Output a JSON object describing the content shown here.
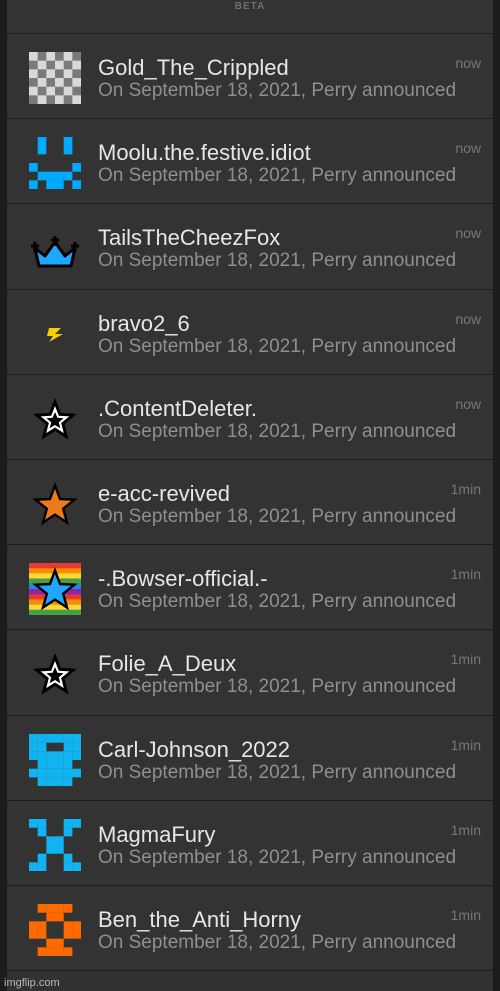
{
  "header": {
    "label": "BETA"
  },
  "items": [
    {
      "name": "Gold_The_Crippled",
      "subtitle": "On September 18, 2021, Perry announced",
      "time": "now",
      "icon": "checkerboard-icon",
      "color": "#d9d9d9"
    },
    {
      "name": "Moolu.the.festive.idiot",
      "subtitle": "On September 18, 2021, Perry announced",
      "time": "now",
      "icon": "pixel-face-icon",
      "color": "#00aaff"
    },
    {
      "name": "TailsTheCheezFox",
      "subtitle": "On September 18, 2021, Perry announced",
      "time": "now",
      "icon": "crown-icon",
      "color": "#1ea7ff"
    },
    {
      "name": "bravo2_6",
      "subtitle": "On September 18, 2021, Perry announced",
      "time": "now",
      "icon": "lightning-icon",
      "color": "#f5d000"
    },
    {
      "name": ".ContentDeleter.",
      "subtitle": "On September 18, 2021, Perry announced",
      "time": "now",
      "icon": "star-outline-icon",
      "color": "#ffffff"
    },
    {
      "name": "e-acc-revived",
      "subtitle": "On September 18, 2021, Perry announced",
      "time": "1min",
      "icon": "star-orange-icon",
      "color": "#f07a1a"
    },
    {
      "name": "-.Bowser-official.-",
      "subtitle": "On September 18, 2021, Perry announced",
      "time": "1min",
      "icon": "rainbow-star-icon",
      "color": "#1ea7ff"
    },
    {
      "name": "Folie_A_Deux",
      "subtitle": "On September 18, 2021, Perry announced",
      "time": "1min",
      "icon": "star-outline-icon",
      "color": "#ffffff"
    },
    {
      "name": "Carl-Johnson_2022",
      "subtitle": "On September 18, 2021, Perry announced",
      "time": "1min",
      "icon": "pixel-invader-icon",
      "color": "#11b4f0"
    },
    {
      "name": "MagmaFury",
      "subtitle": "On September 18, 2021, Perry announced",
      "time": "1min",
      "icon": "pixel-x-icon",
      "color": "#11b4f0"
    },
    {
      "name": "Ben_the_Anti_Horny",
      "subtitle": "On September 18, 2021, Perry announced",
      "time": "1min",
      "icon": "pixel-cross-icon",
      "color": "#ff6a00"
    }
  ],
  "watermark": "imgflip.com"
}
